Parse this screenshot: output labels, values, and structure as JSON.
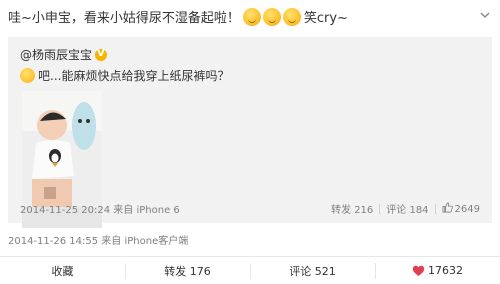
{
  "post": {
    "text_before": "哇~小申宝，看来小姑得尿不湿备起啦！",
    "emoji_names": [
      "giggle-emoji",
      "giggle-emoji",
      "giggle-emoji"
    ],
    "text_after": "笑cry~",
    "meta": "2014-11-26 14:55 来自 iPhone客户端"
  },
  "repost": {
    "user": "@杨雨辰宝宝",
    "text": "吧...能麻烦快点给我穿上纸尿裤吗？",
    "meta": "2014-11-25 20:24 来自 iPhone 6",
    "stats": {
      "repost": "转发 216",
      "comment": "评论 184",
      "like": "2649"
    }
  },
  "actions": {
    "favorite": "收藏",
    "repost": "转发 176",
    "comment": "评论 521",
    "like": "17632"
  },
  "colors": {
    "repost_bg": "#f2f2f2",
    "meta_text": "#808080",
    "like_heart": "#e04050",
    "verified_badge": "#f5b400"
  }
}
